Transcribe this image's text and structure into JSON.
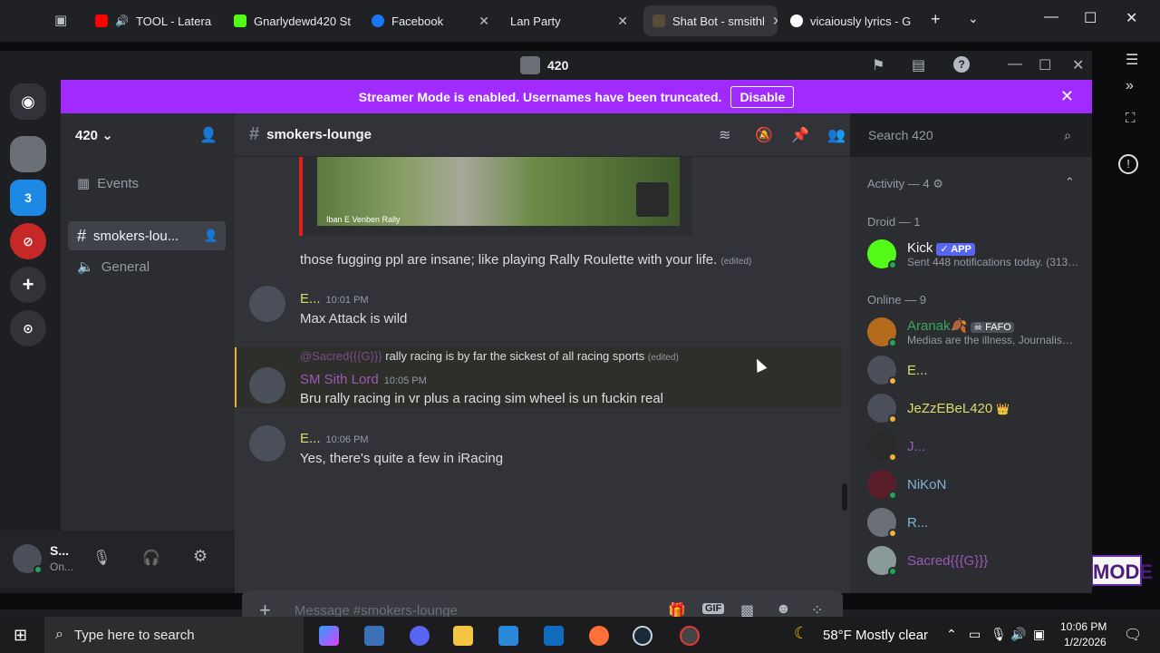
{
  "browser": {
    "tabs": [
      {
        "title": "TOOL - Latera",
        "color": "#ff0000"
      },
      {
        "title": "Gnarlydewd420 St",
        "color": "#53fc18"
      },
      {
        "title": "Facebook",
        "color": "#1877f2"
      },
      {
        "title": "Lan Party",
        "color": "#202124"
      },
      {
        "title": "Shat Bot - smsithl",
        "color": "#5a4a3a"
      },
      {
        "title": "vicaiously lyrics - G",
        "color": "#4285f4"
      }
    ]
  },
  "discord": {
    "window_title": "420",
    "banner": {
      "text": "Streamer Mode is enabled. Usernames have been truncated.",
      "button": "Disable"
    },
    "guild_name": "420",
    "channels": [
      {
        "label": "Events",
        "icon": "calendar-icon"
      },
      {
        "label": "smokers-lou...",
        "icon": "hash-icon"
      },
      {
        "label": "General",
        "icon": "speaker-icon"
      }
    ],
    "server_badge": "3",
    "channel_header": "smokers-lounge",
    "search_placeholder": "Search 420",
    "embed_caption": "Iban E Venben Rally",
    "messages": [
      {
        "text": "those fugging ppl are insane;  like playing Rally Roulette with your life.",
        "edited": "(edited)"
      },
      {
        "user": "E...",
        "time": "10:01 PM",
        "text": "Max Attack is wild",
        "color": "#dcdb6a"
      },
      {
        "reply_user": "@Sacred{{{G}}}",
        "reply_text": "rally racing is by far the sickest of all racing sports",
        "reply_edited": "(edited)",
        "user": "SM Sith Lord",
        "time": "10:05 PM",
        "text": "Bru rally racing in vr plus a racing sim wheel is un fuckin real",
        "color": "#9b59b6"
      },
      {
        "user": "E...",
        "time": "10:06 PM",
        "text": "Yes, there's quite a few in iRacing",
        "color": "#dcdb6a"
      }
    ],
    "composer_placeholder": "Message #smokers-lounge",
    "user_panel": {
      "name": "S...",
      "status": "On..."
    },
    "members": {
      "activity_header": "Activity — 4",
      "droid_header": "Droid — 1",
      "online_header": "Online — 9",
      "droid": [
        {
          "name": "Kick",
          "badge": "✓ APP",
          "sub": "Sent 448 notifications today. (3131 ...",
          "color": "#f2f3f5"
        }
      ],
      "online": [
        {
          "name": "Aranak🍂",
          "tag": "FAFO",
          "sub": "Medias are the illness, Journalism ...",
          "color": "#3ba55d"
        },
        {
          "name": "E...",
          "color": "#dcdb6a"
        },
        {
          "name": "JeZzEBeL420",
          "crown": "👑",
          "color": "#dcdb6a"
        },
        {
          "name": "J...",
          "color": "#9b59b6"
        },
        {
          "name": "NiKoN",
          "color": "#7fb3d5"
        },
        {
          "name": "R...",
          "color": "#7fb3d5"
        },
        {
          "name": "Sacred{{{G}}}",
          "color": "#9b59b6"
        }
      ]
    }
  },
  "taskbar": {
    "search_placeholder": "Type here to search",
    "weather": "58°F  Mostly clear",
    "time": "10:06 PM",
    "date": "1/2/2026"
  },
  "overlay": {
    "mode_text": "MODE"
  }
}
